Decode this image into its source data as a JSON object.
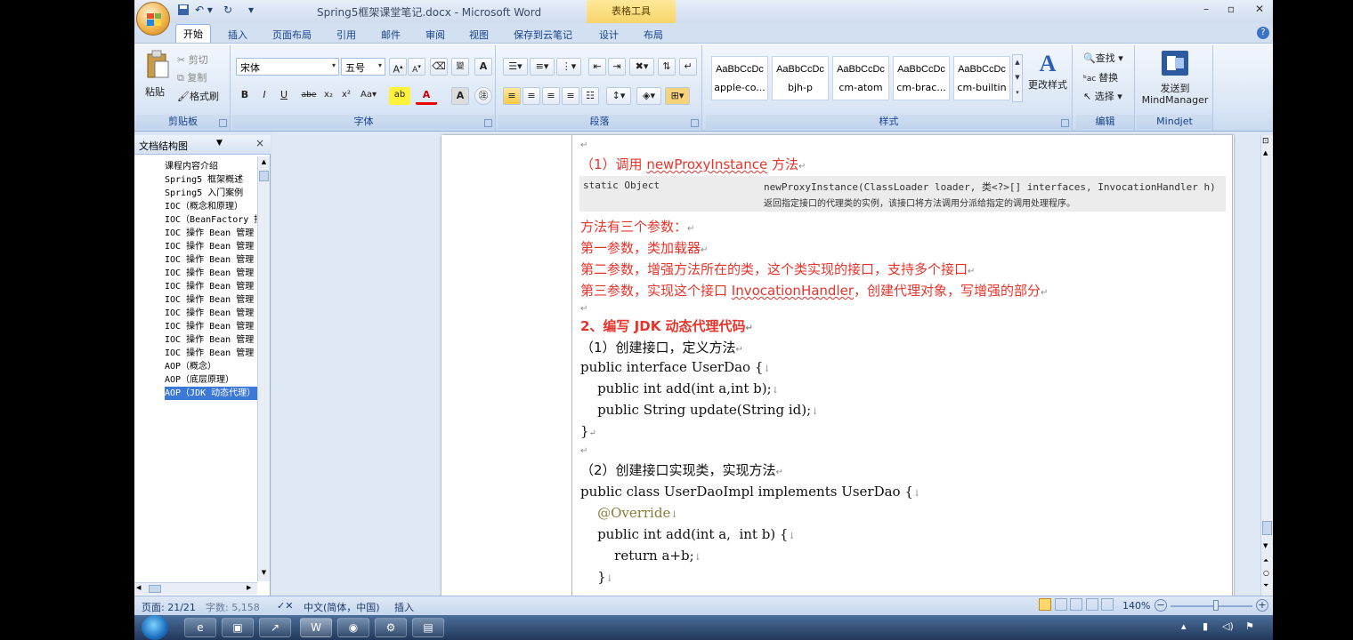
{
  "window": {
    "title": "Spring5框架课堂笔记.docx - Microsoft Word",
    "context_tab_title": "表格工具",
    "controls": [
      "–",
      "▫",
      "✕"
    ]
  },
  "tabs": [
    "开始",
    "插入",
    "页面布局",
    "引用",
    "邮件",
    "审阅",
    "视图",
    "保存到云笔记",
    "设计",
    "布局"
  ],
  "ribbon": {
    "clipboard": {
      "paste": "粘贴",
      "cut": "剪切",
      "copy": "复制",
      "format_painter": "格式刷",
      "label": "剪贴板"
    },
    "font": {
      "name": "宋体",
      "size": "五号",
      "label": "字体"
    },
    "paragraph": {
      "label": "段落"
    },
    "styles": {
      "items": [
        {
          "sample": "AaBbCcDc",
          "name": "apple-co..."
        },
        {
          "sample": "AaBbCcDc",
          "name": "bjh-p"
        },
        {
          "sample": "AaBbCcDc",
          "name": "cm-atom"
        },
        {
          "sample": "AaBbCcDc",
          "name": "cm-brac..."
        },
        {
          "sample": "AaBbCcDc",
          "name": "cm-builtin"
        }
      ],
      "change": "更改样式",
      "label": "样式"
    },
    "editing": {
      "find": "查找",
      "replace": "替换",
      "select": "选择",
      "label": "编辑"
    },
    "mindjet": {
      "send1": "发送到",
      "send2": "MindManager",
      "label": "Mindjet"
    }
  },
  "navpane": {
    "title": "文档结构图",
    "items": [
      "课程内容介绍",
      "Spring5 框架概述",
      "Spring5 入门案例",
      "IOC（概念和原理）",
      "IOC（BeanFactory 接",
      "IOC 操作 Bean 管理（",
      "IOC 操作 Bean 管理（",
      "IOC 操作 Bean 管理（",
      "IOC 操作 Bean 管理（",
      "IOC 操作 Bean 管理（",
      "IOC 操作 Bean 管理（",
      "IOC 操作 Bean 管理（",
      "IOC 操作 Bean 管理（",
      "IOC 操作 Bean 管理（",
      "IOC 操作 Bean 管理（",
      "AOP（概念）",
      "AOP（底层原理）",
      "AOP（JDK 动态代理）"
    ],
    "selected_index": 17
  },
  "document": {
    "step1_prefix": "（1）调用 ",
    "step1_method": "newProxyInstance",
    "step1_suffix": " 方法",
    "api_modifier": "static Object",
    "api_signature": "newProxyInstance(ClassLoader loader, 类<?>[] interfaces, InvocationHandler h)",
    "api_desc": "返回指定接口的代理类的实例，该接口将方法调用分派给指定的调用处理程序。",
    "params_title": "方法有三个参数：",
    "param1": "第一参数，类加载器",
    "param2": "第二参数，增强方法所在的类，这个类实现的接口，支持多个接口",
    "param3_a": "第三参数，实现这个接口 ",
    "param3_b": "InvocationHandler",
    "param3_c": "，创建代理对象，写增强的部分",
    "section2": "2、编写 JDK 动态代理代码",
    "sub1": "（1）创建接口，定义方法",
    "code1": [
      "public interface UserDao {",
      "    public int add(int a,int b);",
      "    public String update(String id);",
      "}"
    ],
    "sub2": "（2）创建接口实现类，实现方法",
    "code2": [
      "public class UserDaoImpl implements UserDao {",
      "    @Override",
      "    public int add(int a,  int b) {",
      "        return a+b;",
      "    }"
    ]
  },
  "status": {
    "page": "页面: 21/21",
    "words": "字数: 5,158",
    "language": "中文(简体，中国)",
    "mode": "插入",
    "zoom": "140%"
  }
}
